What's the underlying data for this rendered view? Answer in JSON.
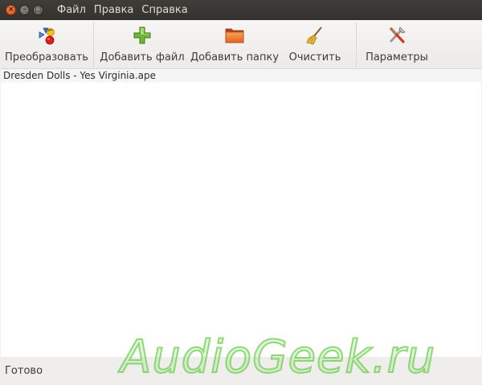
{
  "menu": {
    "items": [
      {
        "label": "Файл"
      },
      {
        "label": "Правка"
      },
      {
        "label": "Справка"
      }
    ]
  },
  "toolbar": {
    "buttons": [
      {
        "label": "Преобразовать",
        "icon": "convert-icon"
      },
      {
        "label": "Добавить файл",
        "icon": "add-icon"
      },
      {
        "label": "Добавить папку",
        "icon": "folder-icon"
      },
      {
        "label": "Очистить",
        "icon": "broom-icon"
      },
      {
        "label": "Параметры",
        "icon": "tools-icon"
      }
    ]
  },
  "file_list": {
    "items": [
      "Dresden Dolls - Yes Virginia.ape"
    ]
  },
  "status": {
    "text": "Готово"
  },
  "watermark": "AudioGeek.ru",
  "colors": {
    "titlebar": "#3c3b37",
    "close_button": "#dd4814",
    "watermark_green": "#6ecd50"
  }
}
